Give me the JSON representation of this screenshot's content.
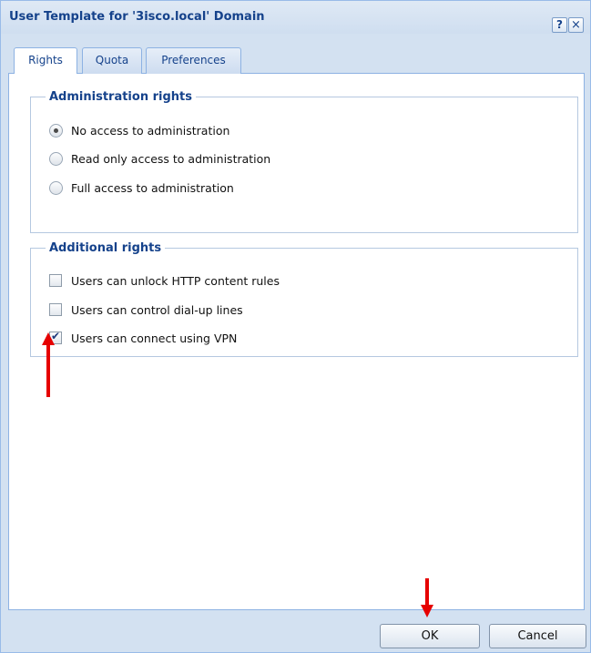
{
  "window": {
    "title": "User Template for '3isco.local' Domain",
    "help_label": "?",
    "close_label": "×"
  },
  "tabs": [
    {
      "label": "Rights",
      "active": true
    },
    {
      "label": "Quota",
      "active": false
    },
    {
      "label": "Preferences",
      "active": false
    }
  ],
  "admin_rights": {
    "legend": "Administration rights",
    "options": [
      {
        "label": "No access to administration",
        "selected": true
      },
      {
        "label": "Read only access to administration",
        "selected": false
      },
      {
        "label": "Full access to administration",
        "selected": false
      }
    ]
  },
  "additional_rights": {
    "legend": "Additional rights",
    "options": [
      {
        "label": "Users can unlock HTTP content rules",
        "checked": false
      },
      {
        "label": "Users can control dial-up lines",
        "checked": false
      },
      {
        "label": "Users can connect using VPN",
        "checked": true
      }
    ]
  },
  "buttons": {
    "ok": "OK",
    "cancel": "Cancel"
  },
  "colors": {
    "title_text": "#15428b",
    "frame": "#d3e1f1",
    "annotation_arrow": "#e60000"
  }
}
